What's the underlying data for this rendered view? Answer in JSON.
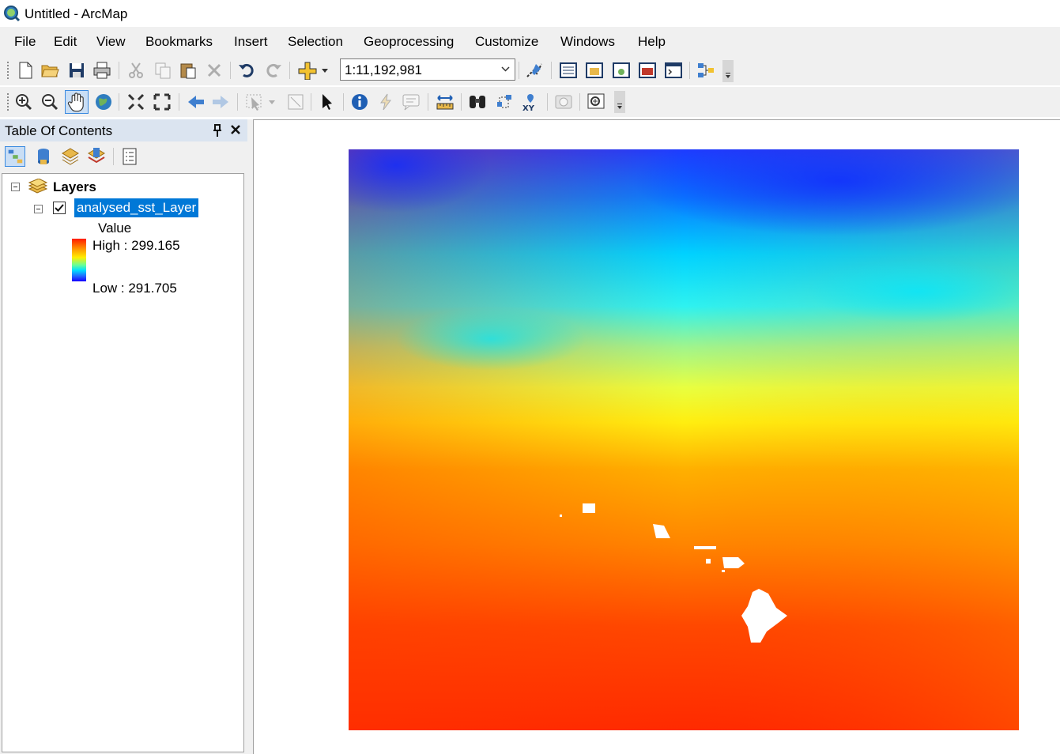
{
  "window": {
    "title": "Untitled - ArcMap",
    "app_icon": "arcmap-globe-icon"
  },
  "menu": [
    "File",
    "Edit",
    "View",
    "Bookmarks",
    "Insert",
    "Selection",
    "Geoprocessing",
    "Customize",
    "Windows",
    "Help"
  ],
  "standard_toolbar": {
    "scale": "1:11,192,981",
    "icons": [
      "new-document-icon",
      "open-folder-icon",
      "save-icon",
      "print-icon",
      "cut-icon",
      "copy-icon",
      "paste-icon",
      "delete-icon",
      "undo-icon",
      "redo-icon",
      "add-data-icon",
      "editor-toolbar-icon",
      "table-of-contents-icon",
      "catalog-icon",
      "search-window-icon",
      "arctoolbox-icon",
      "python-window-icon",
      "modelbuilder-icon"
    ]
  },
  "tools_toolbar": {
    "icons": [
      "zoom-in-icon",
      "zoom-out-icon",
      "pan-icon",
      "full-extent-icon",
      "fixed-zoom-in-icon",
      "fixed-zoom-out-icon",
      "back-extent-icon",
      "forward-extent-icon",
      "select-features-icon",
      "clear-selection-icon",
      "select-elements-icon",
      "identify-icon",
      "hyperlink-icon",
      "html-popup-icon",
      "measure-icon",
      "find-icon",
      "find-route-icon",
      "go-to-xy-icon",
      "time-slider-icon",
      "create-viewer-window-icon"
    ]
  },
  "toc": {
    "title": "Table Of Contents",
    "tabs": [
      "list-by-drawing-order-icon",
      "list-by-source-icon",
      "list-by-visibility-icon",
      "list-by-selection-icon",
      "options-icon"
    ],
    "data_frame": "Layers",
    "layer": {
      "name": "analysed_sst_Layer",
      "checked": true,
      "field": "Value",
      "high": "High : 299.165",
      "low": "Low : 291.705"
    }
  },
  "colors": {
    "selection": "#0078d7",
    "ramp_high": "#ff1a00",
    "ramp_low": "#1400ff",
    "toc_header": "#dbe4f0"
  }
}
